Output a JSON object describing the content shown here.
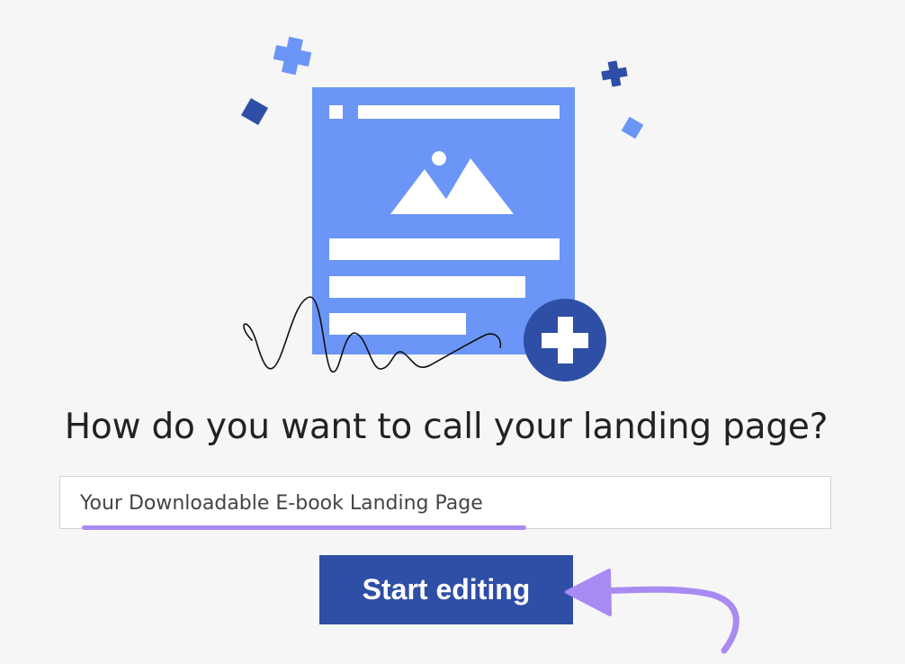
{
  "heading": {
    "question": "How do you want to call your landing page?"
  },
  "name_field": {
    "value": "Your Downloadable E-book Landing Page"
  },
  "actions": {
    "start_label": "Start editing"
  },
  "colors": {
    "page_background": "#f6f6f6",
    "card_blue": "#6b95f7",
    "dark_blue": "#2f4ea6",
    "accent_purple": "#a98af2"
  },
  "icons": {
    "card": "landing-page-card-icon",
    "image": "image-placeholder-icon",
    "add": "plus-circle-icon",
    "arrow": "curved-arrow-icon"
  }
}
